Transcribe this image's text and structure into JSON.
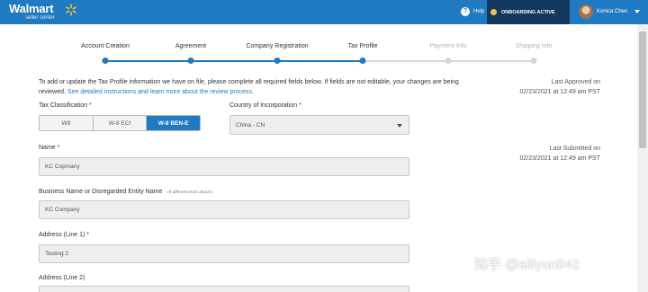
{
  "brand": {
    "name": "Walmart",
    "sub": "seller center"
  },
  "header": {
    "help_label": "Help",
    "help_icon": "?",
    "onboarding_status": "ONBOARDING ACTIVE",
    "user_name": "Konica Chen"
  },
  "stepper": {
    "steps": [
      {
        "label": "Account Creation",
        "state": "done"
      },
      {
        "label": "Agreement",
        "state": "done"
      },
      {
        "label": "Company Registration",
        "state": "done"
      },
      {
        "label": "Tax Profile",
        "state": "current"
      },
      {
        "label": "Payment Info",
        "state": "pending"
      },
      {
        "label": "Shipping Info",
        "state": "pending"
      }
    ]
  },
  "intro": {
    "text": "To add or update the Tax Profile information we have on file, please complete all required fields below. If fields are not editable, your changes are being reviewed.",
    "link": "See detailed instructions and learn more about the review process."
  },
  "last_approved": {
    "label": "Last Approved on",
    "value": "02/23/2021 at 12:49 am PST"
  },
  "last_submitted": {
    "label": "Last Submitted on",
    "value": "02/23/2021 at 12:49 am PST"
  },
  "tax_classification": {
    "label": "Tax Classification",
    "options": [
      "W9",
      "W-8 ECI",
      "W-8 BEN-E"
    ],
    "selected": "W-8 BEN-E"
  },
  "country": {
    "label": "Country of Incorporation",
    "value": "China - CN"
  },
  "name_field": {
    "label": "Name",
    "value": "KC Copmany"
  },
  "business_name": {
    "label": "Business Name or Disregarded Entity Name",
    "hint": "(if different from above)",
    "value": "KC Company"
  },
  "address1": {
    "label": "Address (Line 1)",
    "value": "Testing 2"
  },
  "address2": {
    "label": "Address (Line 2)"
  },
  "required_mark": "*",
  "watermark": "知乎 @ailiyun942",
  "colors": {
    "primary": "#1f7ac4",
    "header_dark": "#13385e",
    "spark": "#ffc220",
    "required": "#d0021b"
  }
}
